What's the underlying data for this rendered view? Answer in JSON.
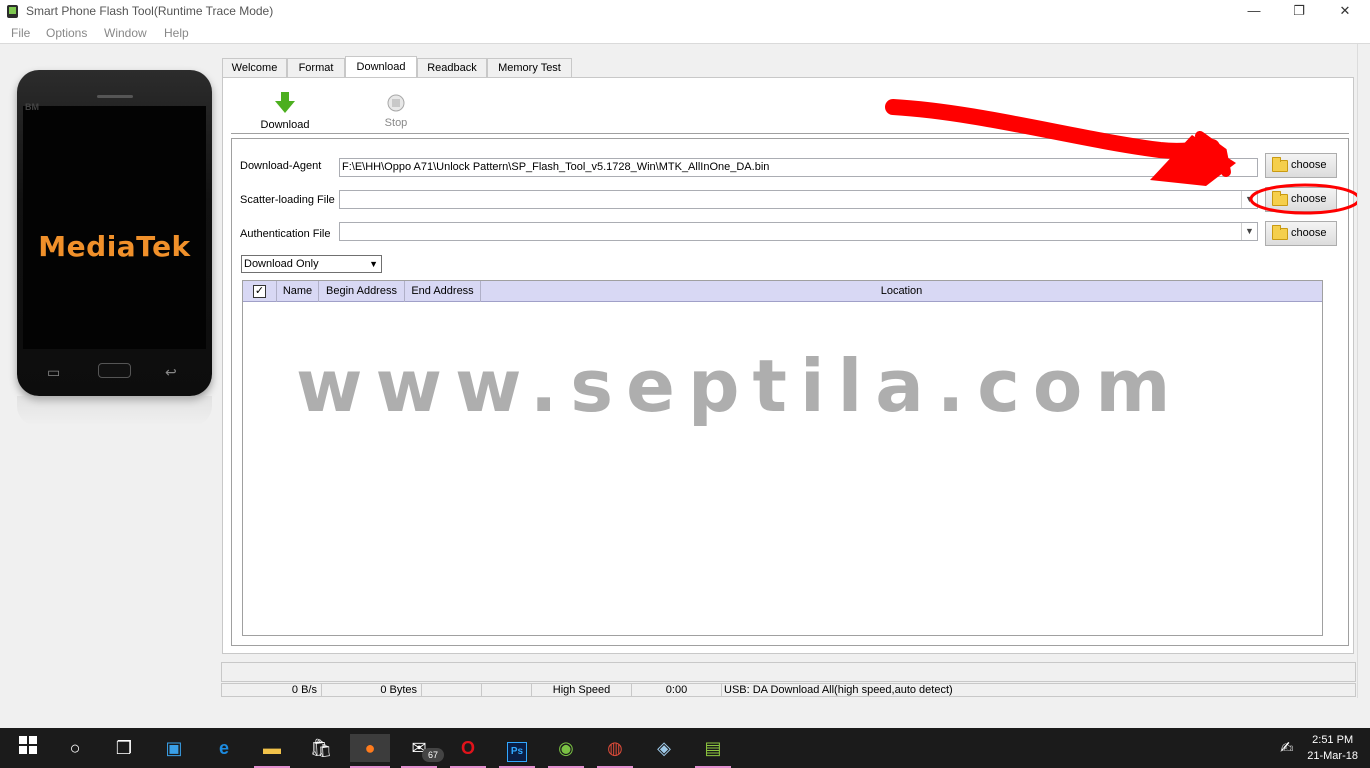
{
  "window": {
    "title": "Smart Phone Flash Tool(Runtime Trace Mode)",
    "minimize_glyph": "—",
    "restore_glyph": "❐",
    "close_glyph": "✕"
  },
  "menu": [
    "File",
    "Options",
    "Window",
    "Help"
  ],
  "phone": {
    "brand": "MediaTek",
    "small_label": "BM"
  },
  "tabs": [
    {
      "label": "Welcome",
      "active": false
    },
    {
      "label": "Format",
      "active": false
    },
    {
      "label": "Download",
      "active": true
    },
    {
      "label": "Readback",
      "active": false
    },
    {
      "label": "Memory Test",
      "active": false
    }
  ],
  "toolbar": {
    "download_label": "Download",
    "stop_label": "Stop"
  },
  "form": {
    "download_agent": {
      "label": "Download-Agent",
      "value": "F:\\E\\HH\\Oppo A71\\Unlock Pattern\\SP_Flash_Tool_v5.1728_Win\\MTK_AllInOne_DA.bin"
    },
    "scatter_file": {
      "label": "Scatter-loading File",
      "value": ""
    },
    "auth_file": {
      "label": "Authentication File",
      "value": ""
    },
    "choose_label": "choose",
    "mode": "Download Only"
  },
  "table": {
    "checked": true,
    "columns": [
      "Name",
      "Begin Address",
      "End Address",
      "Location"
    ],
    "rows": []
  },
  "watermark": "www.septila.com",
  "status": {
    "speed": "0 B/s",
    "bytes": "0 Bytes",
    "mode": "High Speed",
    "time": "0:00",
    "usb": "USB: DA Download All(high speed,auto detect)"
  },
  "taskbar": {
    "mail_badge": "67",
    "time": "2:51 PM",
    "date": "21-Mar-18"
  },
  "annotation_color": "#ff0000"
}
